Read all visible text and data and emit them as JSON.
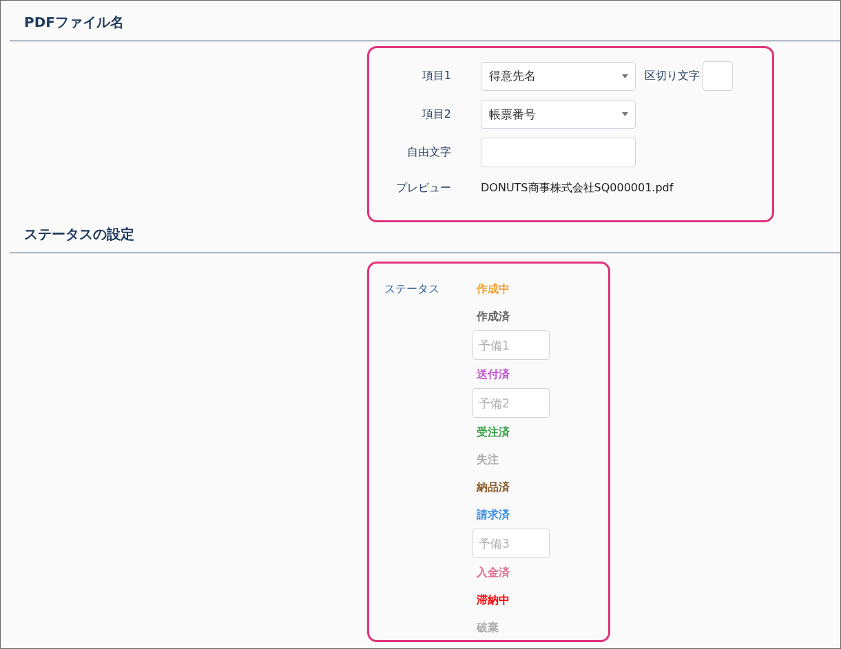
{
  "sections": [
    {
      "title": "PDFファイル名"
    },
    {
      "title": "ステータスの設定"
    }
  ],
  "pdf_filename": {
    "item1": {
      "label": "項目1",
      "value": "得意先名"
    },
    "separator": {
      "label": "区切り文字"
    },
    "item2": {
      "label": "項目2",
      "value": "帳票番号"
    },
    "free_text": {
      "label": "自由文字"
    },
    "preview": {
      "label": "プレビュー",
      "value": "DONUTS商事株式会社SQ000001.pdf"
    }
  },
  "status": {
    "label": "ステータス",
    "items": [
      {
        "kind": "label",
        "text": "作成中",
        "color": "#f0a030"
      },
      {
        "kind": "label",
        "text": "作成済",
        "color": "#666666"
      },
      {
        "kind": "input",
        "placeholder": "予備1"
      },
      {
        "kind": "label",
        "text": "送付済",
        "color": "#c050d0"
      },
      {
        "kind": "input",
        "placeholder": "予備2"
      },
      {
        "kind": "label",
        "text": "受注済",
        "color": "#30a040"
      },
      {
        "kind": "label",
        "text": "失注",
        "color": "#aaaaaa"
      },
      {
        "kind": "label",
        "text": "納品済",
        "color": "#8b5a2b"
      },
      {
        "kind": "label",
        "text": "請求済",
        "color": "#3a8ee0"
      },
      {
        "kind": "input",
        "placeholder": "予備3"
      },
      {
        "kind": "label",
        "text": "入金済",
        "color": "#e07090"
      },
      {
        "kind": "label",
        "text": "滞納中",
        "color": "#ff0000"
      },
      {
        "kind": "label",
        "text": "破棄",
        "color": "#acacac"
      }
    ]
  }
}
